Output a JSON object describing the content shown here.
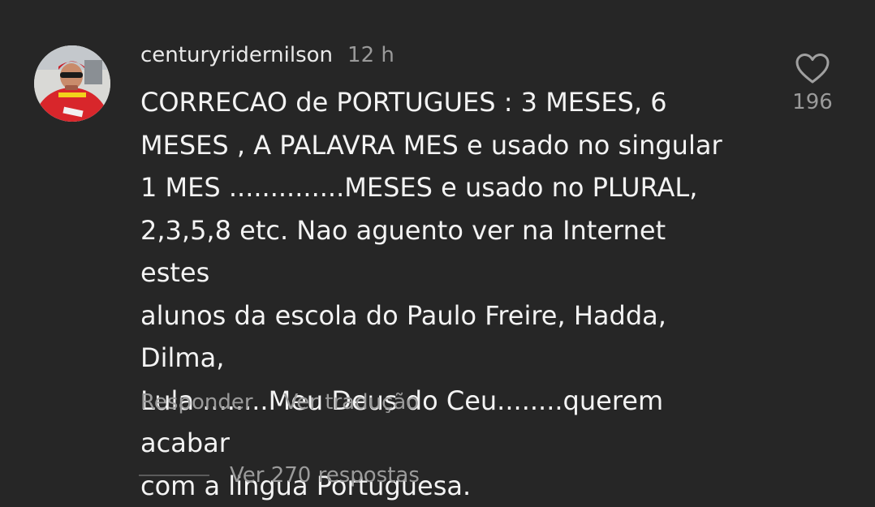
{
  "comment": {
    "username": "centuryridernilson",
    "timestamp": "12 h",
    "text": "CORRECAO de PORTUGUES :  3 MESES, 6\nMESES , A PALAVRA MES  e usado no singular\n1 MES ..............MESES e usado no PLURAL,\n2,3,5,8 etc. Nao aguento ver na Internet estes\nalunos da escola do Paulo Freire, Hadda, Dilma,\nLula ........Meu Deus do Ceu........querem acabar\ncom a lingua Portuguesa.",
    "reply_label": "Responder",
    "translate_label": "Ver tradução",
    "like_count": "196",
    "view_replies_label": "Ver 270 respostas"
  },
  "icons": {
    "like": "heart-outline-icon",
    "avatar": "user-avatar"
  },
  "colors": {
    "background": "#262626",
    "primary_text": "#f3f3f3",
    "secondary_text": "#9b9b9b"
  }
}
